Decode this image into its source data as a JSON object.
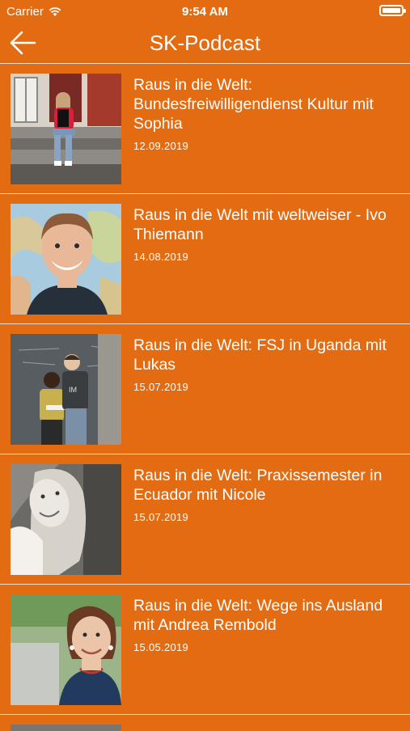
{
  "status_bar": {
    "carrier": "Carrier",
    "time": "9:54 AM"
  },
  "nav": {
    "title": "SK-Podcast"
  },
  "episodes": [
    {
      "title": "Raus in die Welt: Bundesfreiwilligendienst Kultur mit Sophia",
      "date": "12.09.2019"
    },
    {
      "title": "Raus in die Welt mit weltweiser - Ivo Thiemann",
      "date": "14.08.2019"
    },
    {
      "title": "Raus in die Welt: FSJ in Uganda mit Lukas",
      "date": "15.07.2019"
    },
    {
      "title": "Raus in die Welt: Praxissemester in Ecuador mit Nicole",
      "date": "15.07.2019"
    },
    {
      "title": "Raus in die Welt: Wege ins Ausland mit Andrea Rembold",
      "date": "15.05.2019"
    }
  ],
  "colors": {
    "background": "#e36c12",
    "text": "#ffffff"
  }
}
